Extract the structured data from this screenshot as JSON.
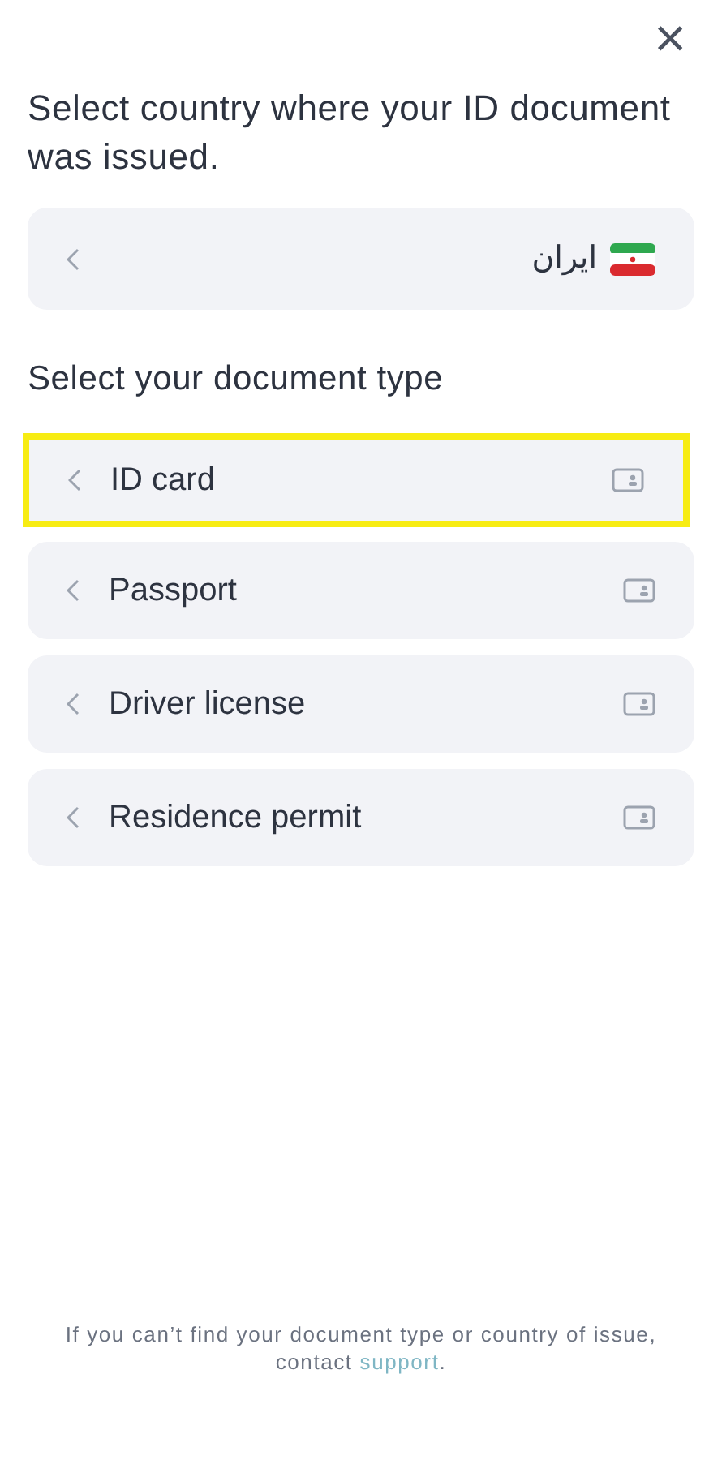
{
  "close_button": "×",
  "title": "Select country where your ID document was issued.",
  "country": {
    "name": "ایران"
  },
  "section_title": "Select your document type",
  "document_types": [
    {
      "label": "ID card",
      "selected": true
    },
    {
      "label": "Passport",
      "selected": false
    },
    {
      "label": "Driver license",
      "selected": false
    },
    {
      "label": "Residence permit",
      "selected": false
    }
  ],
  "footer": {
    "text": "If you can’t find your document type or country of issue, contact",
    "link": "support",
    "end": "."
  }
}
